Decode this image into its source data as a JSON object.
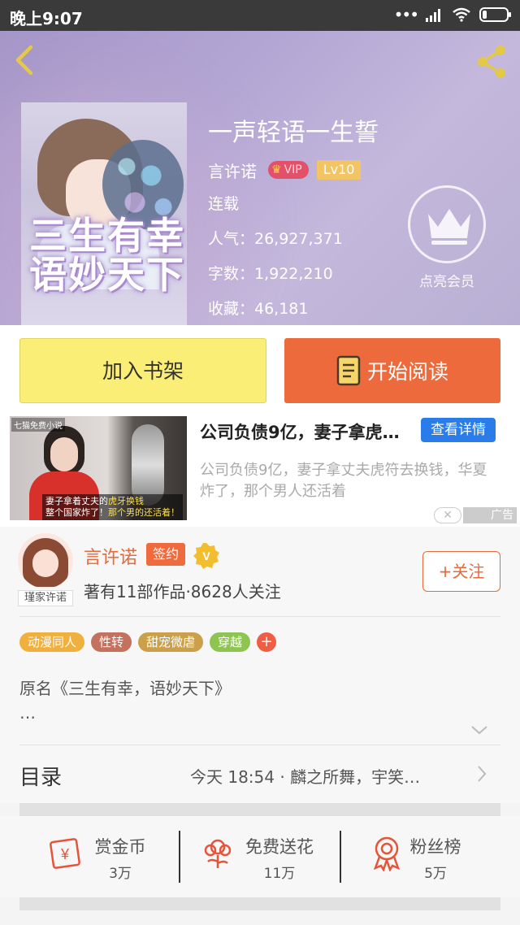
{
  "status_bar": {
    "time": "晚上9:07"
  },
  "book": {
    "title": "一声轻语一生誓",
    "author": "言许诺",
    "vip": "VIP",
    "level": "Lv10",
    "status": "连载",
    "popularity": "人气：26,927,371",
    "word_count": "字数：1,922,210",
    "favorites": "收藏：46,181",
    "cover_text": "三生有幸\n语妙天下",
    "member_label": "点亮会员"
  },
  "actions": {
    "add_shelf": "加入书架",
    "start_read": "开始阅读"
  },
  "ad": {
    "title": "公司负债9亿，妻子拿虎…",
    "detail_button": "查看详情",
    "description": "公司负债9亿，妻子拿丈夫虎符去换钱，华夏炸了，那个男人还活着",
    "label": "广告",
    "image_brand": "七猫免费小说",
    "image_caption_1": "妻子拿着丈夫的",
    "image_caption_hl1": "虎牙换钱",
    "image_caption_2": "整个国家炸了！",
    "image_caption_hl2": "那个男的还活着！"
  },
  "author": {
    "name": "言许诺",
    "sign_badge": "签约",
    "stats": "著有11部作品·8628人关注",
    "avatar_tag": "瑾家许诺",
    "follow_button": "+关注"
  },
  "tags": [
    {
      "label": "动漫同人",
      "color": "#f0b03e"
    },
    {
      "label": "性转",
      "color": "#c4715f"
    },
    {
      "label": "甜宠微虐",
      "color": "#caa04a"
    },
    {
      "label": "穿越",
      "color": "#8ec450"
    }
  ],
  "tag_plus": "+",
  "description": {
    "line1": "原名《三生有幸，语妙天下》",
    "line2": "…"
  },
  "toc": {
    "label": "目录",
    "latest": "今天 18:54 · 麟之所舞，宇笑…"
  },
  "rewards": [
    {
      "title": "赏金币",
      "count": "3万"
    },
    {
      "title": "免费送花",
      "count": "11万"
    },
    {
      "title": "粉丝榜",
      "count": "5万"
    }
  ],
  "colors": {
    "accent": "#ec6a3b",
    "shelf_yellow": "#fbee76",
    "ad_blue": "#2a7de8"
  }
}
